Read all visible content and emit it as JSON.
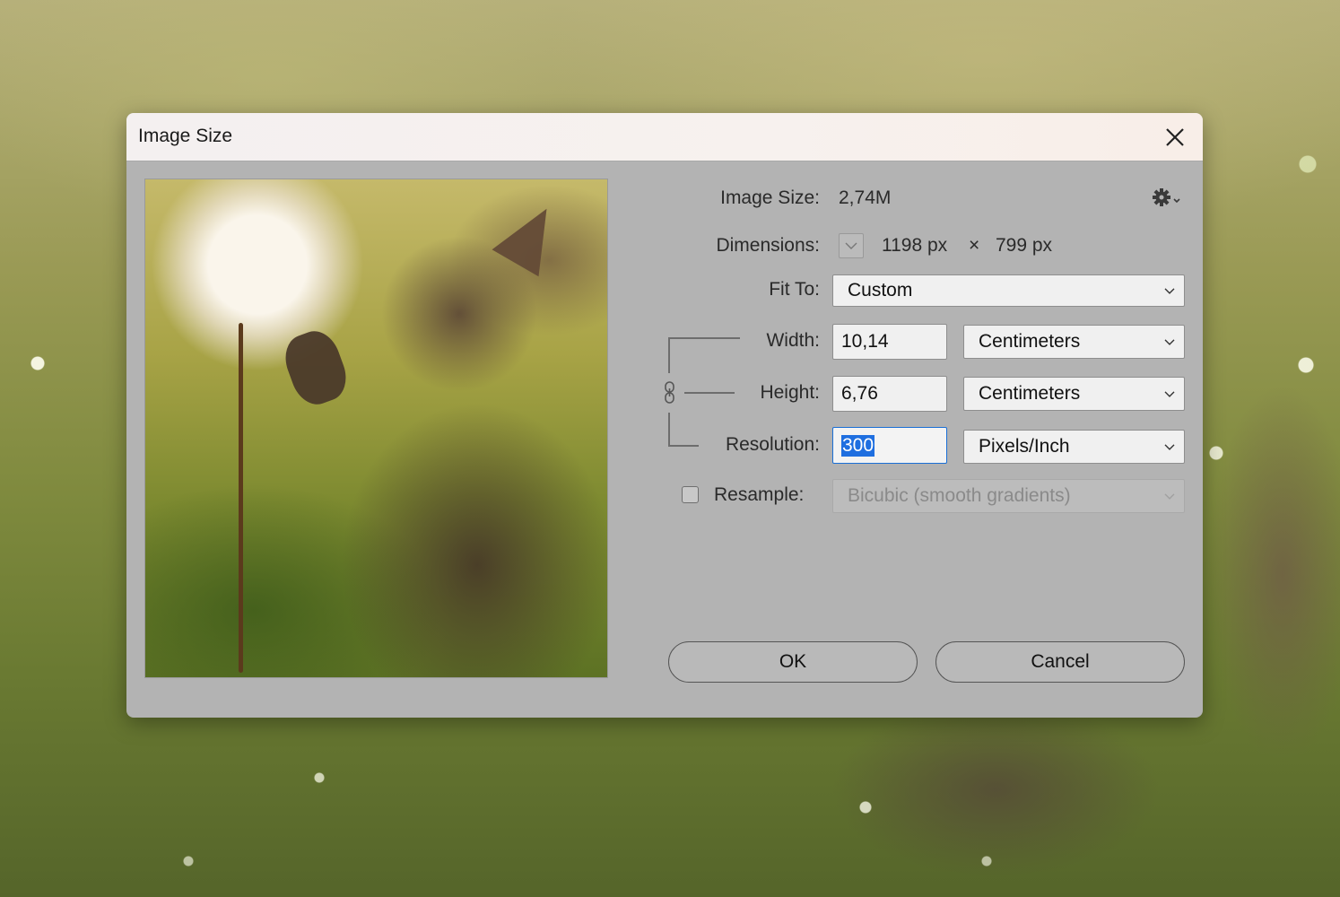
{
  "dialog": {
    "title": "Image Size",
    "image_size": {
      "label": "Image Size:",
      "value": "2,74M"
    },
    "dimensions": {
      "label": "Dimensions:",
      "width": "1198 px",
      "separator": "×",
      "height": "799 px"
    },
    "fit_to": {
      "label": "Fit To:",
      "value": "Custom"
    },
    "width": {
      "label": "Width:",
      "value": "10,14",
      "unit": "Centimeters"
    },
    "height": {
      "label": "Height:",
      "value": "6,76",
      "unit": "Centimeters"
    },
    "resolution": {
      "label": "Resolution:",
      "value": "300",
      "unit": "Pixels/Inch"
    },
    "resample": {
      "label": "Resample:",
      "checked": false,
      "method": "Bicubic (smooth gradients)"
    },
    "buttons": {
      "ok": "OK",
      "cancel": "Cancel"
    }
  },
  "icons": {
    "close": "close-icon",
    "gear": "gear-icon",
    "chain": "chain-link-icon",
    "chevron": "chevron-down-icon"
  }
}
